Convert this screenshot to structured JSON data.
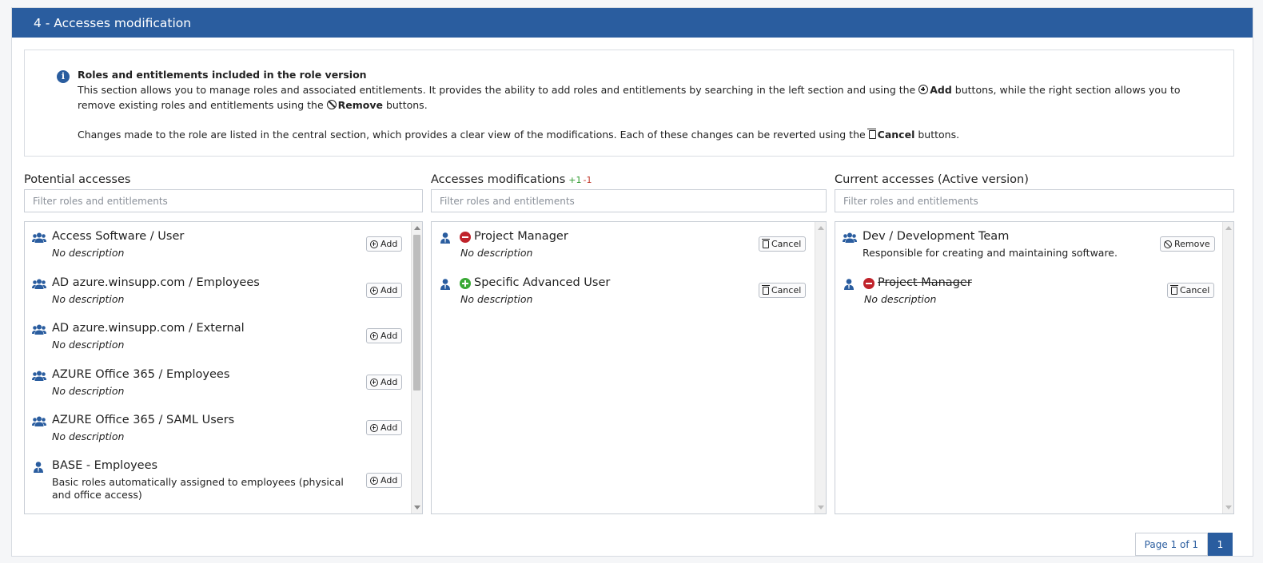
{
  "section": {
    "title": "4 - Accesses modification"
  },
  "info": {
    "title": "Roles and entitlements included in the role version",
    "p1_a": "This section allows you to manage roles and associated entitlements. It provides the ability to add roles and entitlements by searching in the left section and using the",
    "p1_add": "Add",
    "p1_b": "buttons, while the right section allows you to remove existing roles and entitlements using the",
    "p1_remove": "Remove",
    "p1_c": "buttons.",
    "p2_a": "Changes made to the role are listed in the central section, which provides a clear view of the modifications. Each of these changes can be reverted using the",
    "p2_cancel": "Cancel",
    "p2_b": "buttons."
  },
  "potential": {
    "title": "Potential accesses",
    "filter_placeholder": "Filter roles and entitlements",
    "items": [
      {
        "name": "Access Software / User",
        "desc": "No description",
        "icon": "group-icon",
        "button": "Add"
      },
      {
        "name": "AD azure.winsupp.com / Employees",
        "desc": "No description",
        "icon": "group-icon",
        "button": "Add"
      },
      {
        "name": "AD azure.winsupp.com / External",
        "desc": "No description",
        "icon": "group-icon",
        "button": "Add"
      },
      {
        "name": "AZURE Office 365 / Employees",
        "desc": "No description",
        "icon": "group-icon",
        "button": "Add"
      },
      {
        "name": "AZURE Office 365 / SAML Users",
        "desc": "No description",
        "icon": "group-icon",
        "button": "Add"
      },
      {
        "name": "BASE - Employees",
        "desc": "Basic roles automatically assigned to employees (physical and office access)",
        "icon": "user-tie-icon",
        "button": "Add"
      }
    ]
  },
  "modifications": {
    "title": "Accesses modifications",
    "plus_count": "+1",
    "minus_count": "-1",
    "filter_placeholder": "Filter roles and entitlements",
    "items": [
      {
        "name": "Project Manager",
        "desc": "No description",
        "status": "removed",
        "icon": "user-tie-icon",
        "button": "Cancel"
      },
      {
        "name": "Specific Advanced User",
        "desc": "No description",
        "status": "added",
        "icon": "user-tie-icon",
        "button": "Cancel"
      }
    ]
  },
  "current": {
    "title": "Current accesses (Active version)",
    "filter_placeholder": "Filter roles and entitlements",
    "items": [
      {
        "name": "Dev / Development Team",
        "desc": "Responsible for creating and maintaining software.",
        "icon": "group-icon",
        "button": "Remove"
      },
      {
        "name": "Project Manager",
        "desc": "No description",
        "status": "removed",
        "icon": "user-tie-icon",
        "button": "Cancel"
      }
    ]
  },
  "pager": {
    "info": "Page 1 of 1",
    "current": "1"
  },
  "colors": {
    "primary": "#2a5d9f",
    "added": "#3aa935",
    "removed": "#c0232b"
  }
}
